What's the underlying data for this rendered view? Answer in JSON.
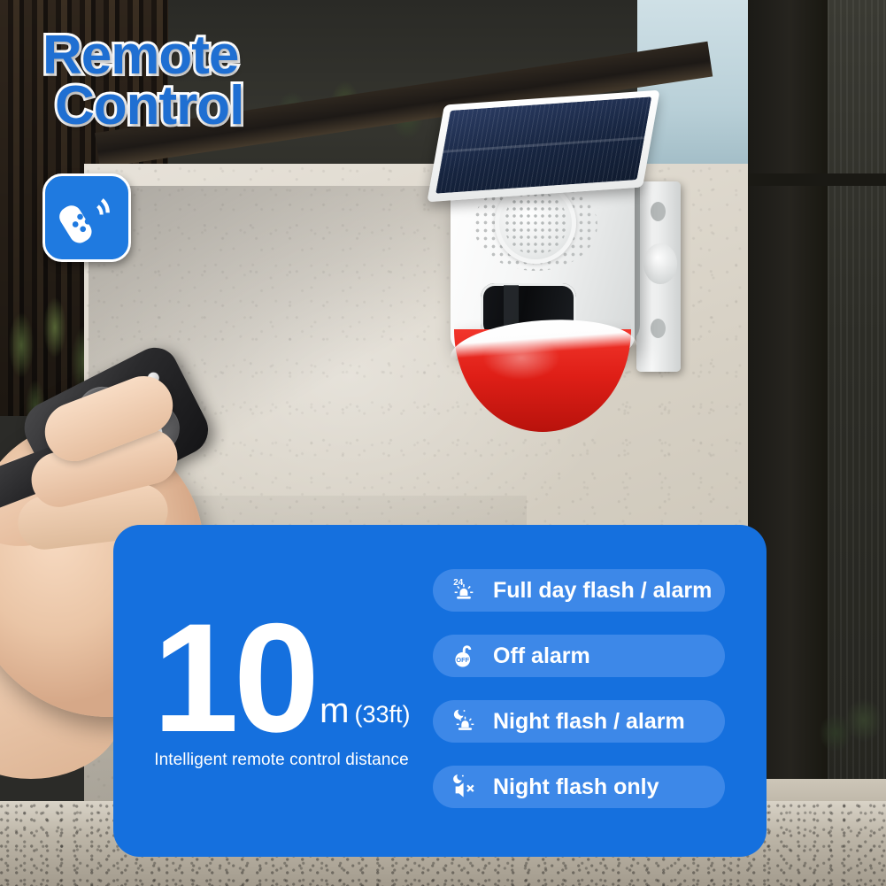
{
  "title": {
    "line1": "Remote",
    "line2": "Control"
  },
  "badge": {
    "icon": "remote-control-signal-icon"
  },
  "product": {
    "name": "solar-outdoor-strobe-siren-alarm",
    "parts": {
      "solar_panel": "solar-panel",
      "speaker_grille": "speaker-grille",
      "siren": "siren-horn",
      "motion_sensor": "pir-motion-sensor-window",
      "strobe_dome": "red-strobe-dome",
      "wall_mount": "wall-mount-bracket"
    }
  },
  "remote": {
    "name": "handheld-remote-control",
    "buttons": [
      {
        "id": "full-day",
        "icon": "siren-24h-icon"
      },
      {
        "id": "night-flash-alarm",
        "icon": "moon-siren-icon"
      },
      {
        "id": "off",
        "icon": "padlock-off-icon"
      },
      {
        "id": "night-flash-only",
        "icon": "moon-speaker-mute-icon"
      }
    ]
  },
  "panel": {
    "distance": {
      "value": "10",
      "unit": "m",
      "imperial": "(33ft)",
      "caption": "Intelligent remote control distance"
    },
    "features": [
      {
        "label": "Full day flash / alarm",
        "icon": "siren-24h-icon"
      },
      {
        "label": "Off alarm",
        "icon": "padlock-off-icon"
      },
      {
        "label": "Night flash / alarm",
        "icon": "moon-siren-icon"
      },
      {
        "label": "Night flash only",
        "icon": "moon-speaker-mute-icon"
      }
    ]
  },
  "colors": {
    "panel_blue": "#1570de",
    "pill_blue": "#3d88e8",
    "title_blue": "#1f6fd2",
    "badge_blue": "#1f7ae0",
    "strobe_red": "#df1f17",
    "white": "#ffffff"
  }
}
